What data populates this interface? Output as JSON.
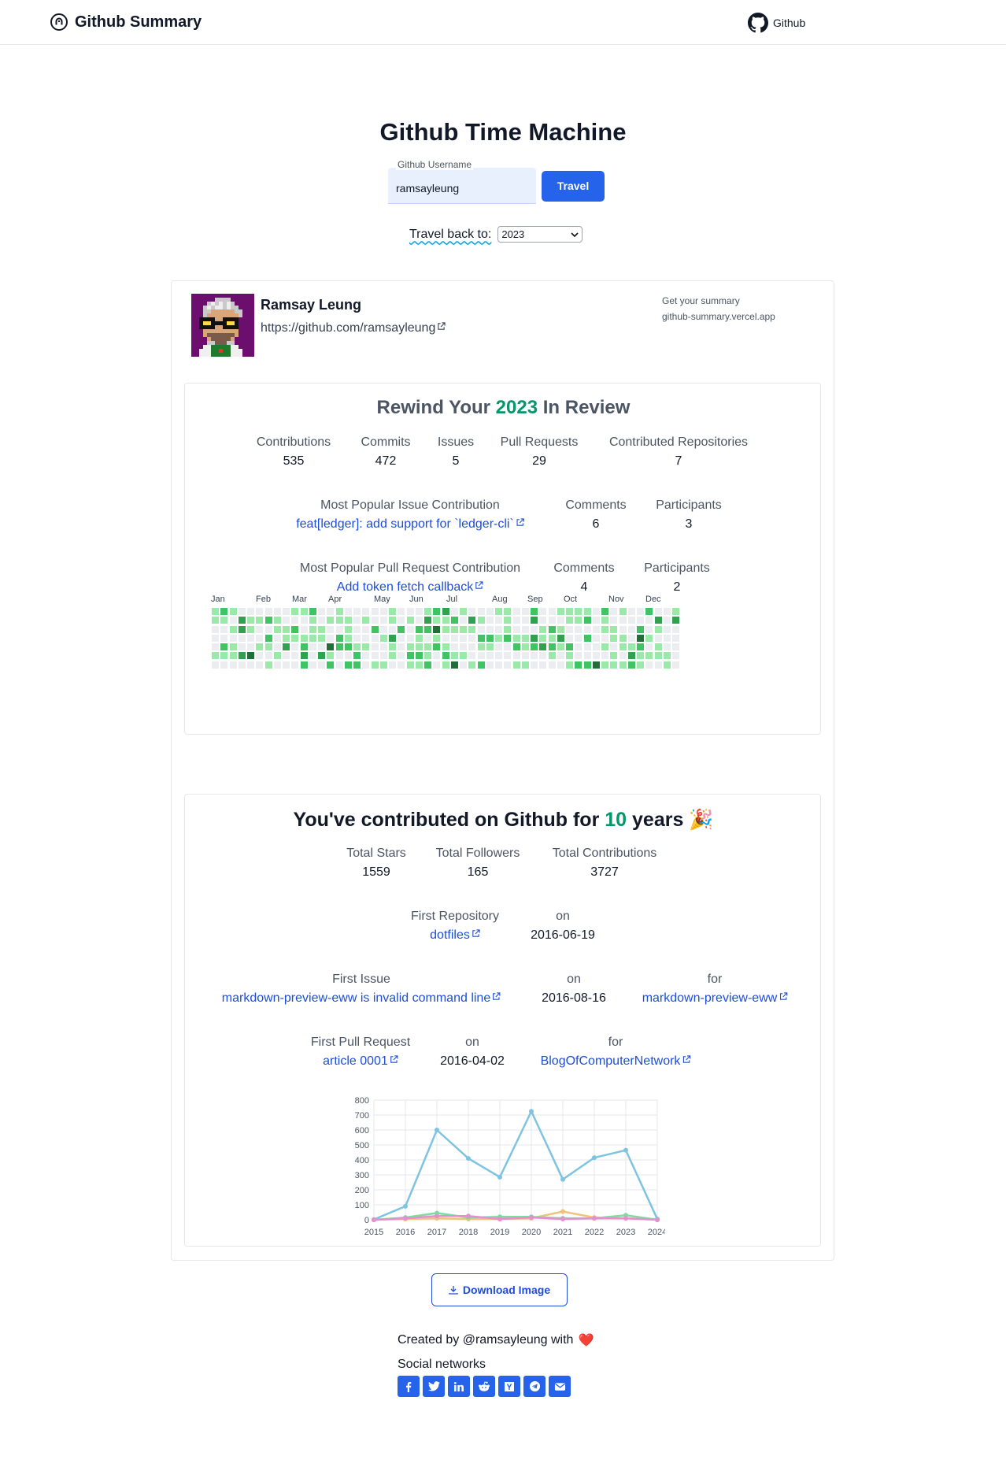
{
  "nav": {
    "brand": "Github Summary",
    "github_link": "Github"
  },
  "hero": {
    "title": "Github Time Machine",
    "username_label": "Github Username",
    "username_value": "ramsayleung",
    "travel_button": "Travel",
    "travel_back_label": "Travel back to:",
    "year_selected": "2023"
  },
  "profile": {
    "name": "Ramsay Leung",
    "url": "https://github.com/ramsayleung",
    "promo_line1": "Get your summary",
    "promo_line2": "github-summary.vercel.app"
  },
  "rewind": {
    "title_prefix": "Rewind Your",
    "year": "2023",
    "title_suffix": "In Review",
    "stats": [
      {
        "label": "Contributions",
        "value": "535"
      },
      {
        "label": "Commits",
        "value": "472"
      },
      {
        "label": "Issues",
        "value": "5"
      },
      {
        "label": "Pull Requests",
        "value": "29"
      },
      {
        "label": "Contributed Repositories",
        "value": "7"
      }
    ],
    "popular_issue": {
      "label": "Most Popular Issue Contribution",
      "title": "feat[ledger]: add support for `ledger-cli`",
      "comments_label": "Comments",
      "comments": "6",
      "participants_label": "Participants",
      "participants": "3"
    },
    "popular_pr": {
      "label": "Most Popular Pull Request Contribution",
      "title": "Add token fetch callback",
      "comments_label": "Comments",
      "comments": "4",
      "participants_label": "Participants",
      "participants": "2"
    },
    "months": [
      "Jan",
      "Feb",
      "Mar",
      "Apr",
      "May",
      "Jun",
      "Jul",
      "Aug",
      "Sep",
      "Oct",
      "Nov",
      "Dec"
    ],
    "heatmap_palette": [
      "#ebedf0",
      "#9be9a8",
      "#40c463",
      "#30a14e",
      "#216e39"
    ]
  },
  "lifetime": {
    "title_prefix": "You've contributed on Github for",
    "years": "10",
    "title_suffix": "years",
    "title_emoji": "🎉",
    "stats": [
      {
        "label": "Total Stars",
        "value": "1559"
      },
      {
        "label": "Total Followers",
        "value": "165"
      },
      {
        "label": "Total Contributions",
        "value": "3727"
      }
    ],
    "first_repo": {
      "label": "First Repository",
      "name": "dotfiles",
      "on_label": "on",
      "date": "2016-06-19"
    },
    "first_issue": {
      "label": "First Issue",
      "title": "markdown-preview-eww is invalid command line",
      "on_label": "on",
      "date": "2016-08-16",
      "for_label": "for",
      "repo": "markdown-preview-eww"
    },
    "first_pr": {
      "label": "First Pull Request",
      "title": "article 0001",
      "on_label": "on",
      "date": "2016-04-02",
      "for_label": "for",
      "repo": "BlogOfComputerNetwork"
    }
  },
  "chart_data": {
    "type": "line",
    "x": [
      "2015",
      "2016",
      "2017",
      "2018",
      "2019",
      "2020",
      "2021",
      "2022",
      "2023",
      "2024"
    ],
    "ylim": [
      0,
      800
    ],
    "yticks": [
      0,
      100,
      200,
      300,
      400,
      500,
      600,
      700,
      800
    ],
    "grid": true,
    "series": [
      {
        "color": "#7ec4e0",
        "values": [
          2,
          90,
          600,
          410,
          285,
          725,
          270,
          415,
          465,
          5
        ]
      },
      {
        "color": "#f0c27b",
        "values": [
          0,
          5,
          10,
          5,
          5,
          10,
          55,
          15,
          10,
          0
        ]
      },
      {
        "color": "#7fdc9f",
        "values": [
          0,
          15,
          45,
          15,
          20,
          20,
          10,
          10,
          30,
          0
        ]
      },
      {
        "color": "#e58fd0",
        "values": [
          0,
          10,
          25,
          25,
          5,
          15,
          5,
          10,
          10,
          0
        ]
      }
    ]
  },
  "footer": {
    "download_label": "Download Image",
    "created_by": "Created by  @ramsayleung with",
    "heart": "❤️",
    "social_label": "Social networks",
    "social_icons": [
      "facebook-icon",
      "twitter-icon",
      "linkedin-icon",
      "reddit-icon",
      "hackernews-icon",
      "telegram-icon",
      "email-icon"
    ]
  }
}
